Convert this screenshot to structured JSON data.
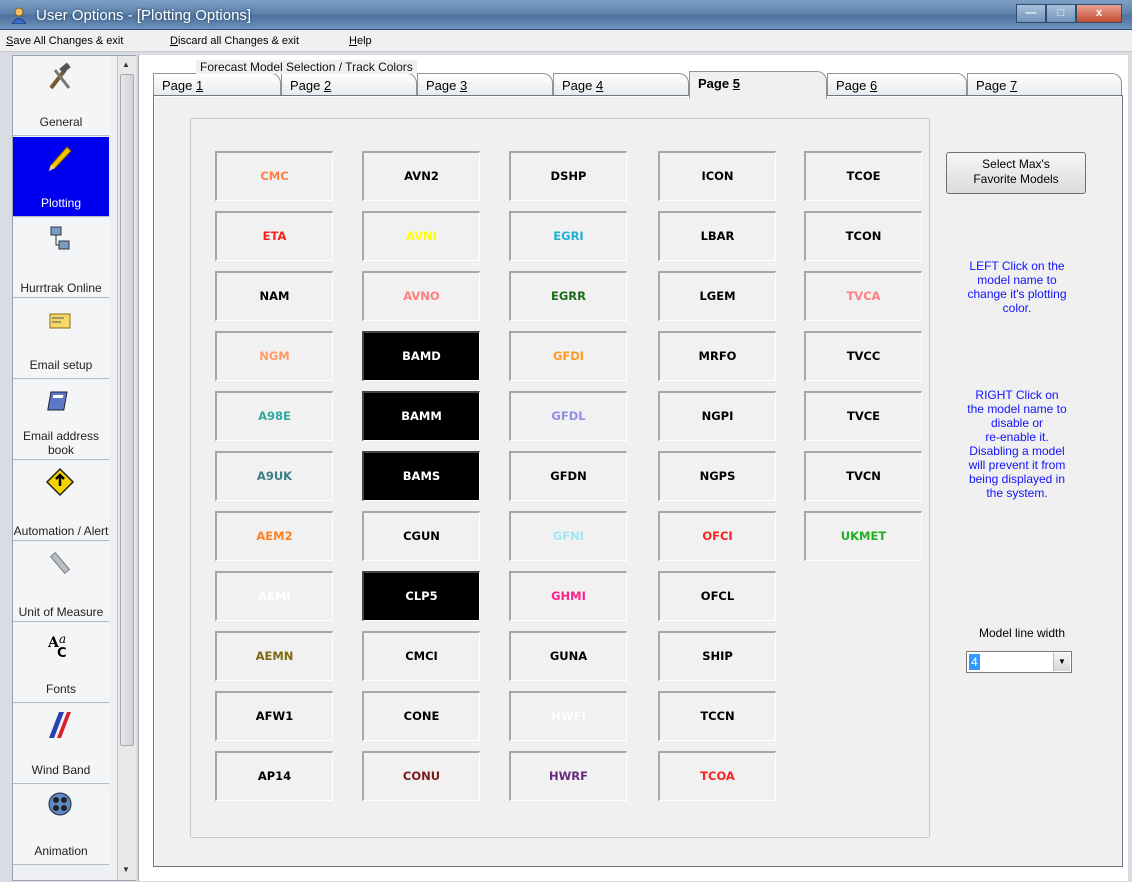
{
  "window": {
    "title": "User Options - [Plotting Options]",
    "minimize": "—",
    "maximize": "□",
    "close": "x"
  },
  "menu": {
    "items": [
      {
        "pre": "",
        "u": "S",
        "post": "ave All Changes & exit"
      },
      {
        "pre": "",
        "u": "D",
        "post": "iscard all Changes & exit"
      },
      {
        "pre": "",
        "u": "H",
        "post": "elp"
      }
    ]
  },
  "sidebar": {
    "selected_index": 1,
    "items": [
      {
        "label": "General",
        "icon": "tools-icon"
      },
      {
        "label": "Plotting",
        "icon": "pencil-icon"
      },
      {
        "label": "Hurrtrak Online",
        "icon": "network-icon"
      },
      {
        "label": "Email setup",
        "icon": "envelope-icon"
      },
      {
        "label": "Email address book",
        "icon": "address-book-icon"
      },
      {
        "label": "Automation / Alert",
        "icon": "alert-icon"
      },
      {
        "label": "Unit of Measure",
        "icon": "ruler-icon"
      },
      {
        "label": "Fonts",
        "icon": "fonts-icon"
      },
      {
        "label": "Wind Band",
        "icon": "wind-band-icon"
      },
      {
        "label": "Animation",
        "icon": "film-icon"
      }
    ]
  },
  "tabs": [
    {
      "pre": "Page ",
      "u": "1",
      "active": false
    },
    {
      "pre": "Page ",
      "u": "2",
      "active": false
    },
    {
      "pre": "Page ",
      "u": "3",
      "active": false
    },
    {
      "pre": "Page ",
      "u": "4",
      "active": false
    },
    {
      "pre": "Page ",
      "u": "5",
      "active": true
    },
    {
      "pre": "Page ",
      "u": "6",
      "active": false
    },
    {
      "pre": "Page ",
      "u": "7",
      "active": false
    }
  ],
  "group_title": "Forecast Model Selection / Track Colors",
  "models": [
    [
      {
        "name": "CMC",
        "color": "#ff8040"
      },
      {
        "name": "ETA",
        "color": "#ff2020"
      },
      {
        "name": "NAM",
        "color": "#000000"
      },
      {
        "name": "NGM",
        "color": "#ff9966"
      },
      {
        "name": "A98E",
        "color": "#33a6a0"
      },
      {
        "name": "A9UK",
        "color": "#3c7d86"
      },
      {
        "name": "AEM2",
        "color": "#ff8020"
      },
      {
        "name": "AEMI",
        "color": "#ffffff"
      },
      {
        "name": "AEMN",
        "color": "#7b6a10"
      },
      {
        "name": "AFW1",
        "color": "#000000"
      },
      {
        "name": "AP14",
        "color": "#000000"
      }
    ],
    [
      {
        "name": "AVN2",
        "color": "#000000"
      },
      {
        "name": "AVNI",
        "color": "#ffff00"
      },
      {
        "name": "AVNO",
        "color": "#ff7f7f"
      },
      {
        "name": "BAMD",
        "color": "#ffffff",
        "black": true
      },
      {
        "name": "BAMM",
        "color": "#ffffff",
        "black": true
      },
      {
        "name": "BAMS",
        "color": "#ffffff",
        "black": true
      },
      {
        "name": "CGUN",
        "color": "#000000"
      },
      {
        "name": "CLP5",
        "color": "#ffffff",
        "black": true
      },
      {
        "name": "CMCI",
        "color": "#000000"
      },
      {
        "name": "CONE",
        "color": "#000000"
      },
      {
        "name": "CONU",
        "color": "#7a1a1a"
      }
    ],
    [
      {
        "name": "DSHP",
        "color": "#000000"
      },
      {
        "name": "EGRI",
        "color": "#20b0d8"
      },
      {
        "name": "EGRR",
        "color": "#1a6d1a"
      },
      {
        "name": "GFDI",
        "color": "#ff9920"
      },
      {
        "name": "GFDL",
        "color": "#8f8fe6"
      },
      {
        "name": "GFDN",
        "color": "#000000"
      },
      {
        "name": "GFNI",
        "color": "#9fe6f0"
      },
      {
        "name": "GHMI",
        "color": "#ff2090"
      },
      {
        "name": "GUNA",
        "color": "#000000"
      },
      {
        "name": "HWFI",
        "color": "#ffffff"
      },
      {
        "name": "HWRF",
        "color": "#6a2a7a"
      }
    ],
    [
      {
        "name": "ICON",
        "color": "#000000"
      },
      {
        "name": "LBAR",
        "color": "#000000"
      },
      {
        "name": "LGEM",
        "color": "#000000"
      },
      {
        "name": "MRFO",
        "color": "#000000"
      },
      {
        "name": "NGPI",
        "color": "#000000"
      },
      {
        "name": "NGPS",
        "color": "#000000"
      },
      {
        "name": "OFCI",
        "color": "#ff2020"
      },
      {
        "name": "OFCL",
        "color": "#000000"
      },
      {
        "name": "SHIP",
        "color": "#000000"
      },
      {
        "name": "TCCN",
        "color": "#000000"
      },
      {
        "name": "TCOA",
        "color": "#ff2020"
      }
    ],
    [
      {
        "name": "TCOE",
        "color": "#000000"
      },
      {
        "name": "TCON",
        "color": "#000000"
      },
      {
        "name": "TVCA",
        "color": "#ff7f7f"
      },
      {
        "name": "TVCC",
        "color": "#000000"
      },
      {
        "name": "TVCE",
        "color": "#000000"
      },
      {
        "name": "TVCN",
        "color": "#000000"
      },
      {
        "name": "UKMET",
        "color": "#20b020"
      }
    ]
  ],
  "favorites_button": {
    "line1": "Select Max's",
    "line2": "Favorite Models"
  },
  "help_left": [
    "LEFT Click on the",
    "model name to",
    "change it's plotting",
    "color."
  ],
  "help_right": [
    "RIGHT Click on",
    "the model name to",
    "disable or",
    "re-enable it.",
    "Disabling a model",
    "will prevent it from",
    "being displayed in",
    "the system."
  ],
  "line_width": {
    "label": "Model line width",
    "value": "4"
  },
  "colors": {
    "sidebar_selected": "#0000f0",
    "help_text": "#1212ff"
  }
}
